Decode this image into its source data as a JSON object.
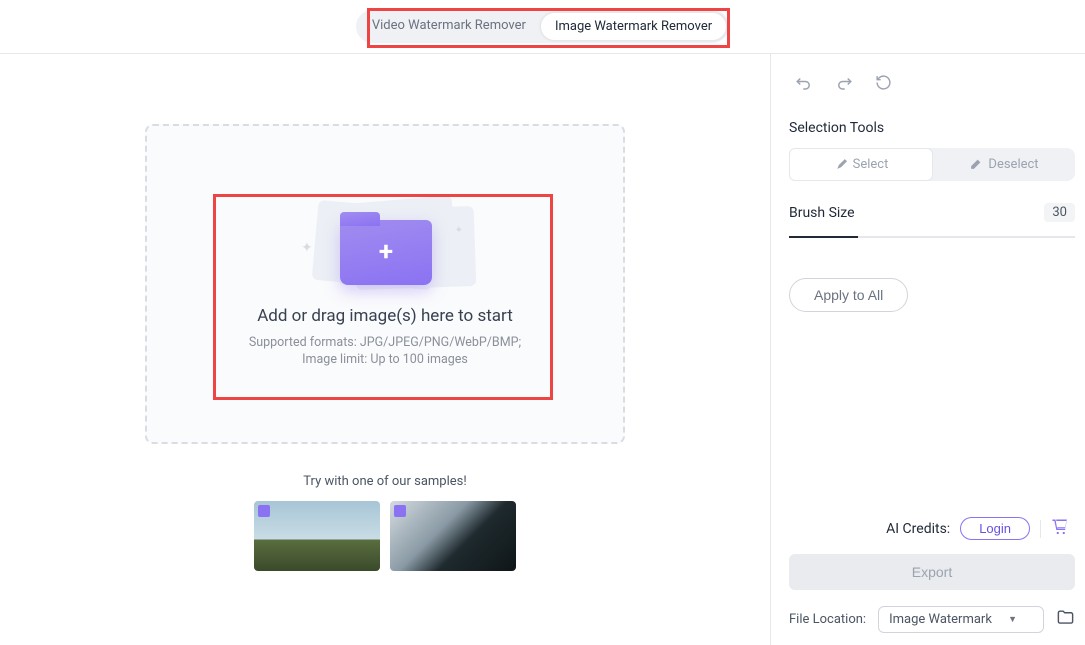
{
  "tabs": {
    "video": "Video Watermark Remover",
    "image": "Image Watermark Remover"
  },
  "dropzone": {
    "title": "Add or drag image(s) here to start",
    "supported": "Supported formats: JPG/JPEG/PNG/WebP/BMP;",
    "limit": "Image limit: Up to 100 images"
  },
  "samples_label": "Try with one of our samples!",
  "sidebar": {
    "selection_title": "Selection Tools",
    "select_label": "Select",
    "deselect_label": "Deselect",
    "brush_label": "Brush Size",
    "brush_value": "30",
    "apply_label": "Apply to All",
    "credits_label": "AI Credits:",
    "login_label": "Login",
    "export_label": "Export",
    "location_label": "File Location:",
    "location_value": "Image Watermark"
  }
}
